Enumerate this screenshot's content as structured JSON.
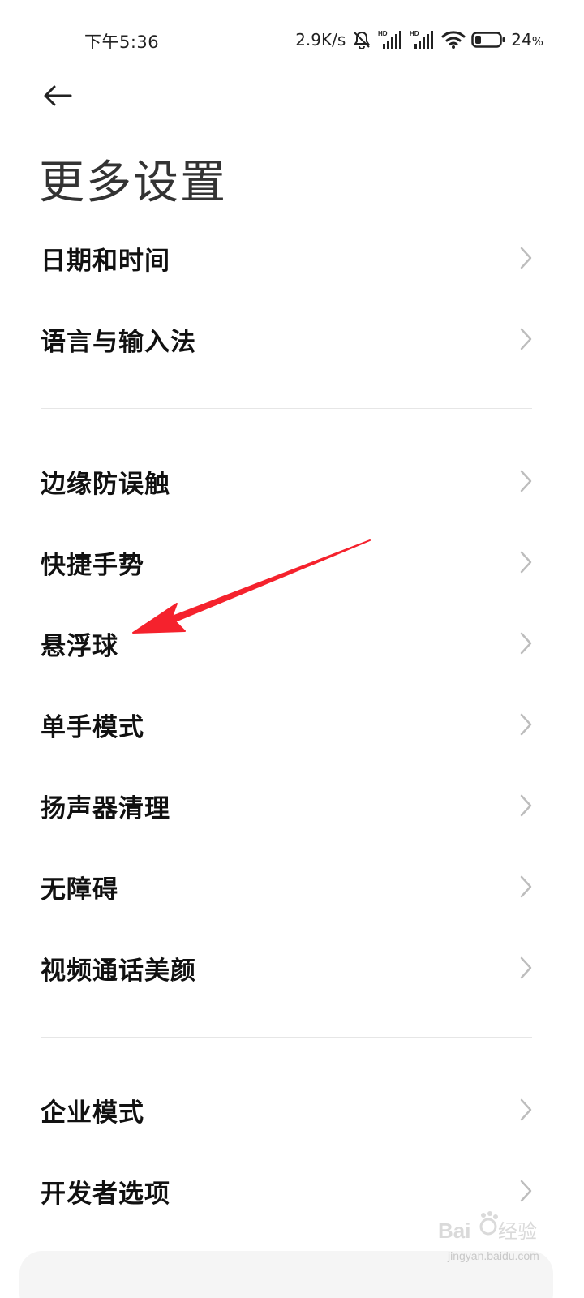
{
  "status_bar": {
    "time": "下午5:36",
    "net_speed": "2.9K/s",
    "battery_pct": "24",
    "battery_unit": "%",
    "icons": [
      "mute-icon",
      "hd-signal-icon",
      "hd-signal-icon",
      "wifi-icon",
      "battery-icon"
    ]
  },
  "header": {
    "back_icon": "back-arrow-icon",
    "title": "更多设置"
  },
  "groups": [
    {
      "items": [
        {
          "label": "日期和时间"
        },
        {
          "label": "语言与输入法"
        }
      ]
    },
    {
      "items": [
        {
          "label": "边缘防误触"
        },
        {
          "label": "快捷手势"
        },
        {
          "label": "悬浮球"
        },
        {
          "label": "单手模式"
        },
        {
          "label": "扬声器清理"
        },
        {
          "label": "无障碍"
        },
        {
          "label": "视频通话美颜"
        }
      ]
    },
    {
      "items": [
        {
          "label": "企业模式"
        },
        {
          "label": "开发者选项"
        }
      ]
    }
  ],
  "annotation": {
    "color": "#f5222d",
    "target": "悬浮球"
  },
  "watermark": {
    "logo": "Baidu经验",
    "url": "jingyan.baidu.com"
  },
  "colors": {
    "text": "#111111",
    "chevron": "#bdbdbd",
    "divider": "#e6e6e6",
    "title": "#333333"
  }
}
